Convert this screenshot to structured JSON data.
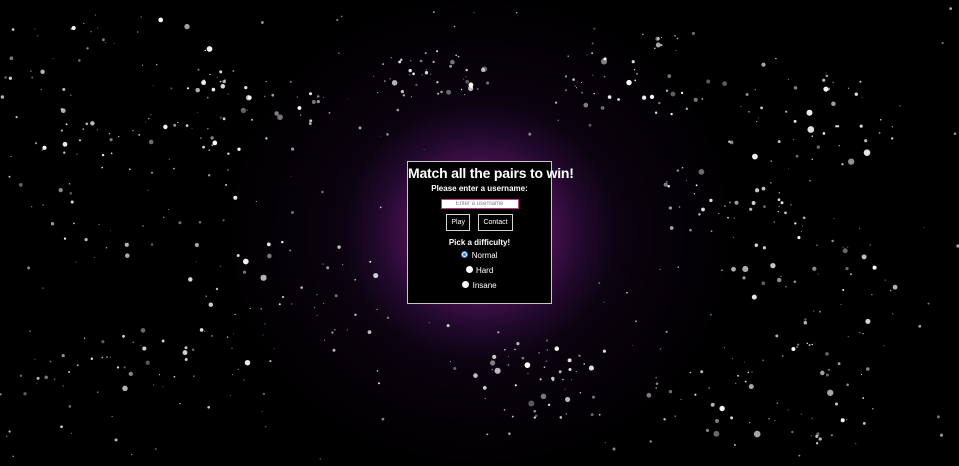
{
  "game": {
    "title": "Match all the pairs to win!",
    "username_prompt": "Please enter a username:",
    "username_placeholder": "Enter a username",
    "username_value": "",
    "play_label": "Play",
    "contact_label": "Contact",
    "difficulty_heading": "Pick a difficulty!",
    "difficulty_options": [
      "Normal",
      "Hard",
      "Insane"
    ],
    "selected_difficulty": "Normal"
  },
  "theme": {
    "background": "#000000",
    "glow": "#7a1470",
    "panel_border": "#c7c7c7",
    "input_border": "#c23a8a",
    "radio_accent": "#2f7de1"
  }
}
